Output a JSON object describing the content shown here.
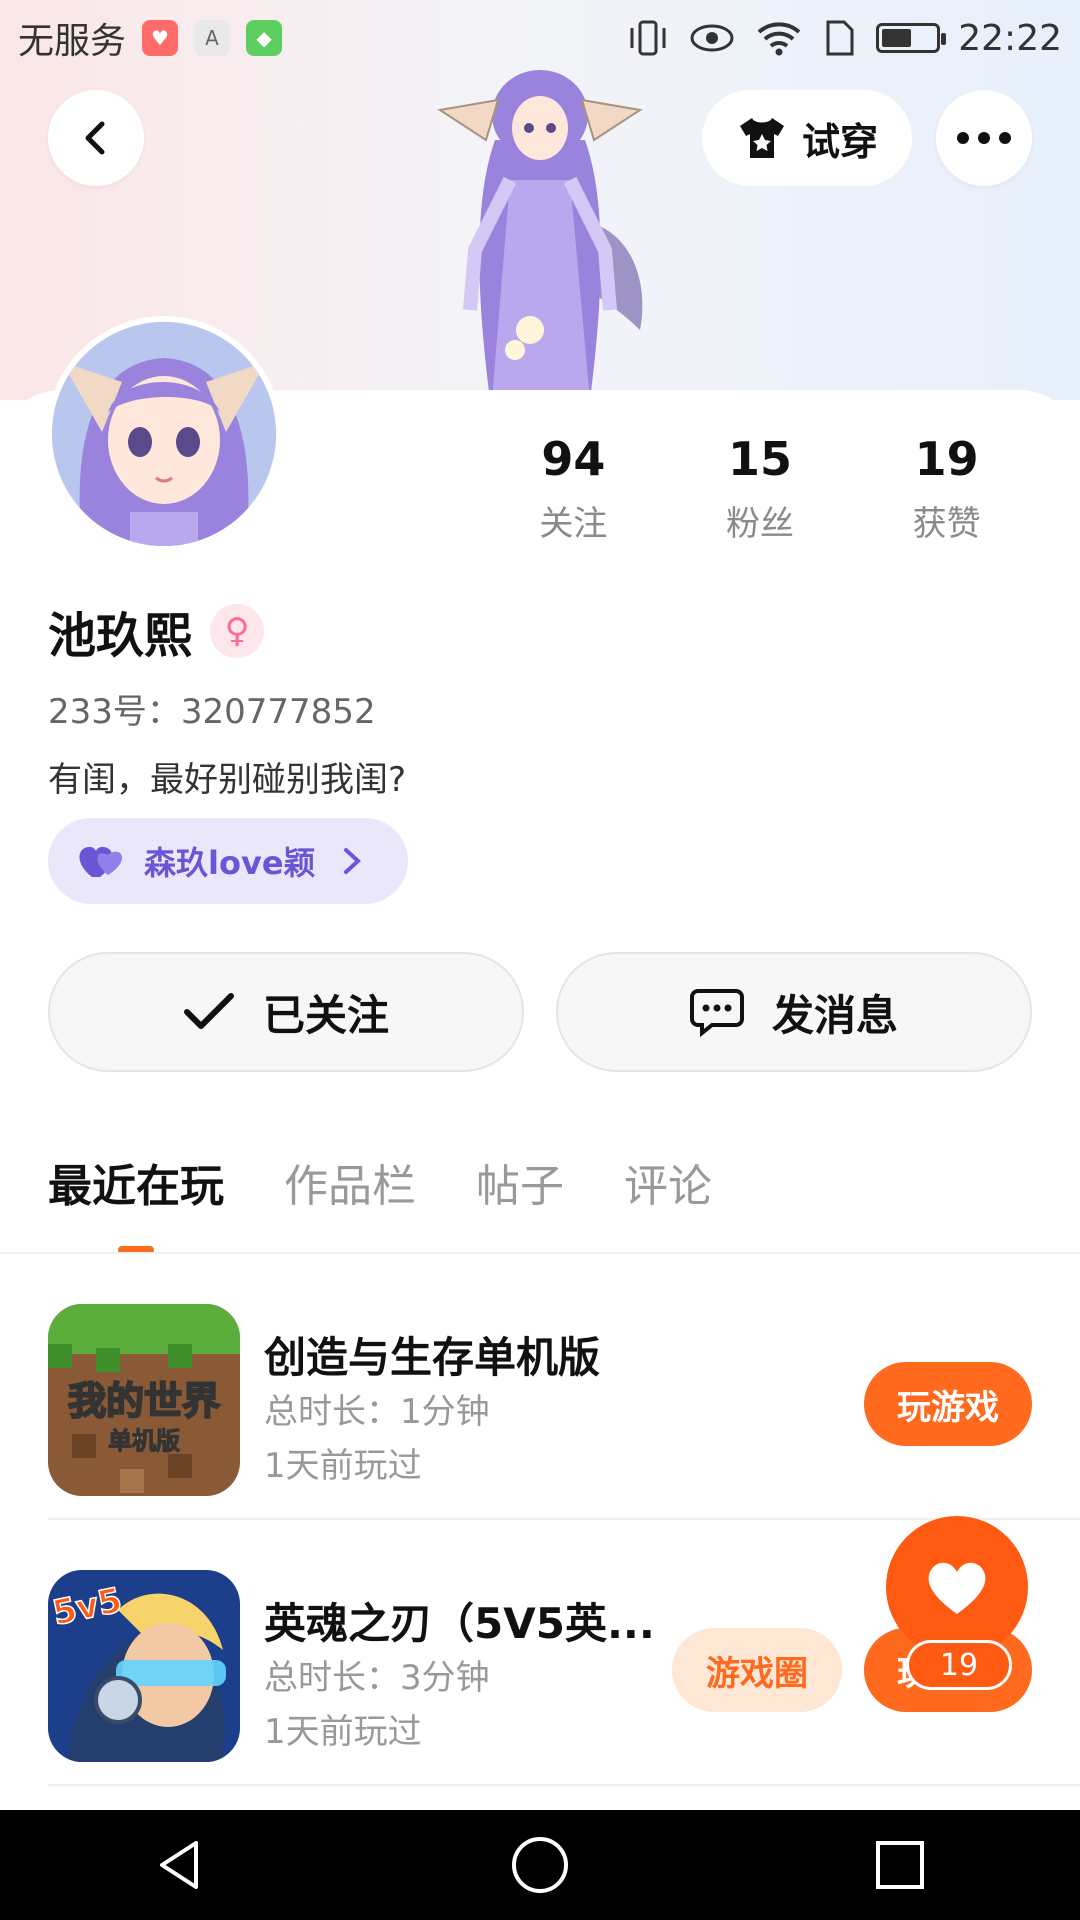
{
  "status_bar": {
    "carrier": "无服务",
    "time": "22:22",
    "battery_level": 0.55
  },
  "header": {
    "back_icon": "chevron-left-icon",
    "try_on_label": "试穿",
    "more_icon": "more-horizontal-icon"
  },
  "profile": {
    "stats": [
      {
        "value": "94",
        "label": "关注"
      },
      {
        "value": "15",
        "label": "粉丝"
      },
      {
        "value": "19",
        "label": "获赞"
      }
    ],
    "name": "池玖熙",
    "gender_symbol": "♀",
    "uid_text": "233号：320777852",
    "bio": "有闺，最好别碰别我闺?",
    "relation_tag": "森玖love颖"
  },
  "actions": {
    "follow_label": "已关注",
    "message_label": "发消息"
  },
  "tabs": [
    {
      "label": "最近在玩",
      "active": true
    },
    {
      "label": "作品栏",
      "active": false
    },
    {
      "label": "帖子",
      "active": false
    },
    {
      "label": "评论",
      "active": false
    }
  ],
  "games": [
    {
      "title": "创造与生存单机版",
      "duration": "总时长：1分钟",
      "last_played": "1天前玩过",
      "play_label": "玩游戏",
      "icon_text": "我的世界",
      "icon_subtext": "单机版"
    },
    {
      "title": "英魂之刃（5V5英...",
      "duration": "总时长：3分钟",
      "last_played": "1天前玩过",
      "circle_label": "游戏圈",
      "play_label": "玩游戏",
      "icon_text": "5v5"
    }
  ],
  "fab": {
    "icon": "heart-icon",
    "count": "19"
  },
  "colors": {
    "accent": "#ff6a1f",
    "purple": "#6856d6"
  }
}
